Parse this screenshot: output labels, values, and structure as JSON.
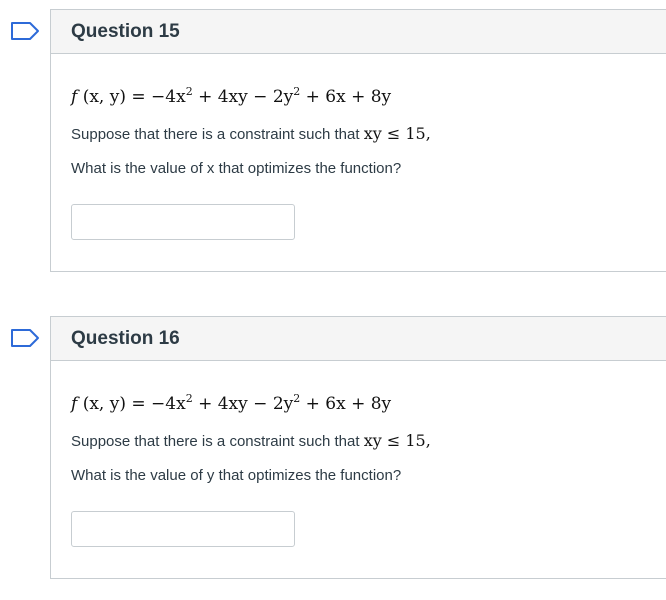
{
  "questions": [
    {
      "title": "Question 15",
      "formula": {
        "f": "f",
        "lhs_args": "(x, y)",
        "eq": "=",
        "t1": "−4x",
        "t1_exp": "2",
        "t2": "+ 4xy −",
        "t3": "2y",
        "t3_exp": "2",
        "t4": "+ 6x + 8y"
      },
      "constraint_text": "Suppose that there is a constraint such that",
      "constraint_math": "xy ≤ 15",
      "constraint_suffix": ",",
      "prompt": "What is the value of x that optimizes the function?",
      "answer_value": ""
    },
    {
      "title": "Question 16",
      "formula": {
        "f": "f",
        "lhs_args": "(x, y)",
        "eq": "=",
        "t1": "−4x",
        "t1_exp": "2",
        "t2": "+ 4xy −",
        "t3": "2y",
        "t3_exp": "2",
        "t4": "+ 6x + 8y"
      },
      "constraint_text": "Suppose that there is a constraint such that",
      "constraint_math": "xy ≤ 15",
      "constraint_suffix": ",",
      "prompt": "What is the value of y that optimizes the function?",
      "answer_value": ""
    }
  ],
  "colors": {
    "flag_stroke": "#2d6ad8",
    "header_bg": "#f5f5f5",
    "border": "#c7cdd1"
  }
}
